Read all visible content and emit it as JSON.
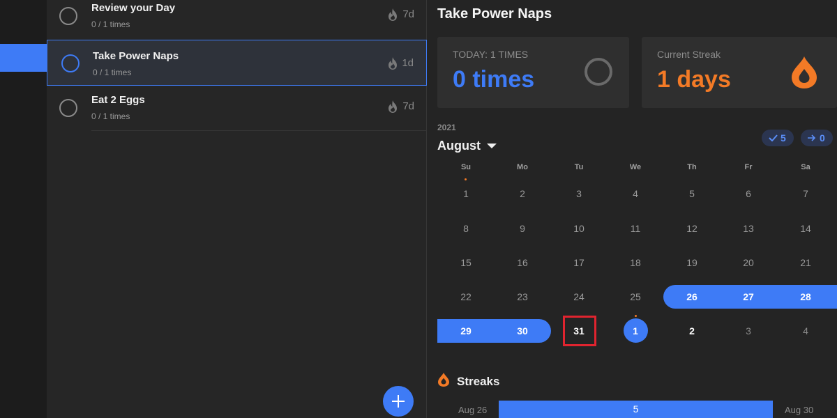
{
  "habits": [
    {
      "name": "Review your Day",
      "count": "0 / 1 times",
      "streak": "7d",
      "selected": false
    },
    {
      "name": "Take Power Naps",
      "count": "0 / 1 times",
      "streak": "1d",
      "selected": true
    },
    {
      "name": "Eat 2 Eggs",
      "count": "0 / 1 times",
      "streak": "7d",
      "selected": false
    }
  ],
  "detail": {
    "title": "Take Power Naps",
    "today_label": "TODAY: 1 TIMES",
    "today_value": "0 times",
    "streak_label": "Current Streak",
    "streak_value": "1 days"
  },
  "calendar": {
    "year": "2021",
    "month": "August",
    "done_count": "5",
    "skip_count": "0",
    "weekdays": [
      "Su",
      "Mo",
      "Tu",
      "We",
      "Th",
      "Fr",
      "Sa"
    ],
    "weeks": [
      [
        "1",
        "2",
        "3",
        "4",
        "5",
        "6",
        "7"
      ],
      [
        "8",
        "9",
        "10",
        "11",
        "12",
        "13",
        "14"
      ],
      [
        "15",
        "16",
        "17",
        "18",
        "19",
        "20",
        "21"
      ],
      [
        "22",
        "23",
        "24",
        "25",
        "26",
        "27",
        "28"
      ],
      [
        "29",
        "30",
        "31",
        "1",
        "2",
        "3",
        "4"
      ]
    ],
    "streak_days": [
      "26",
      "27",
      "28",
      "29",
      "30"
    ],
    "today": "1",
    "highlighted": "31"
  },
  "streaks": {
    "title": "Streaks",
    "start": "Aug 26",
    "length": "5",
    "end": "Aug 30"
  },
  "colors": {
    "accent": "#3e7bf6",
    "streak_orange": "#f37a26",
    "highlight_red": "#e0242f"
  },
  "icons": {
    "fab": "plus-icon",
    "flame": "flame-icon",
    "drop": "drop-icon",
    "caret": "caret-down-icon",
    "check": "check-icon",
    "arrow": "arrow-right-icon"
  }
}
